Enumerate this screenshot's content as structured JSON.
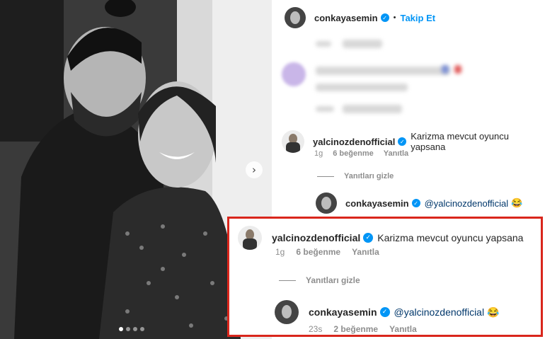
{
  "post": {
    "author": "conkayasemin",
    "follow_label": "Takip Et",
    "separator": "•"
  },
  "comment": {
    "author": "yalcinozdenofficial",
    "text": "Karizma mevcut oyuncu yapsana",
    "time": "1g",
    "likes": "6 beğenme",
    "reply_label": "Yanıtla",
    "hide_replies_label": "Yanıtları gizle"
  },
  "reply": {
    "author": "conkayasemin",
    "mention": "@yalcinozdenofficial",
    "emoji": "😂",
    "time": "23s",
    "likes": "2 beğenme",
    "reply_label": "Yanıtla"
  },
  "icons": {
    "verified": "verified-badge-icon",
    "next": "chevron-right-icon"
  },
  "colors": {
    "accent": "#0095f6",
    "callout_border": "#d9261c",
    "mention": "#00376b",
    "meta": "#8e8e8e"
  },
  "carousel": {
    "slide_count": 4,
    "active_index": 0
  }
}
